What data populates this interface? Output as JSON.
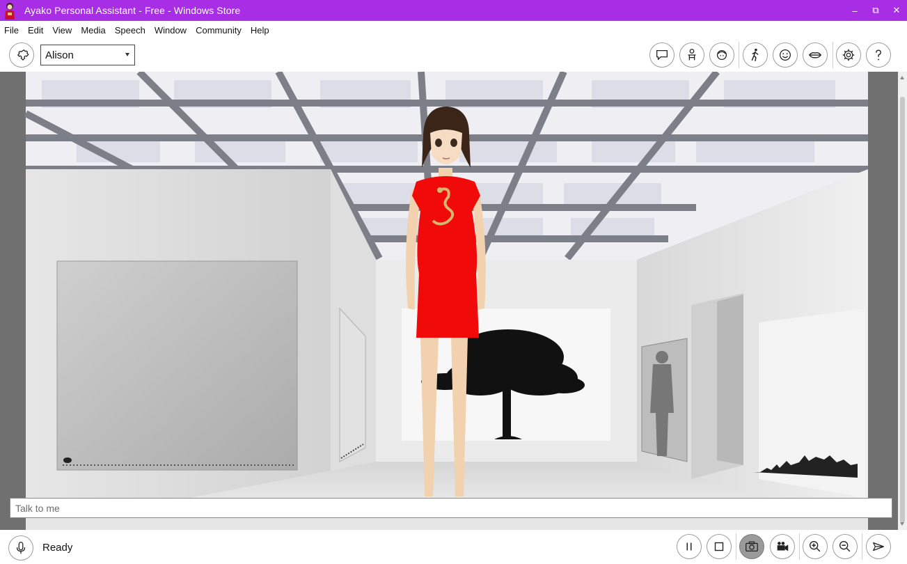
{
  "window": {
    "title": "Ayako Personal Assistant - Free - Windows Store",
    "accent_color": "#a82ee6",
    "controls": {
      "minimize": "–",
      "restore": "⧉",
      "close": "✕"
    }
  },
  "menu": [
    "File",
    "Edit",
    "View",
    "Media",
    "Speech",
    "Window",
    "Community",
    "Help"
  ],
  "toolbar": {
    "character_select": {
      "value": "Alison"
    },
    "left_icon": "puzzle-icon",
    "right_icons": [
      "speech-bubble-icon",
      "character-body-icon",
      "face-icon",
      "pose-icon",
      "smiley-icon",
      "lips-icon",
      "gear-icon",
      "help-icon"
    ]
  },
  "talk": {
    "placeholder": "Talk to me",
    "value": ""
  },
  "status": {
    "text": "Ready",
    "mic_icon": "microphone-icon",
    "media_icons": [
      "pause-icon",
      "stop-icon",
      "camera-icon",
      "video-camera-icon",
      "zoom-in-icon",
      "zoom-out-icon",
      "send-icon"
    ],
    "active_icon": "camera-icon"
  }
}
